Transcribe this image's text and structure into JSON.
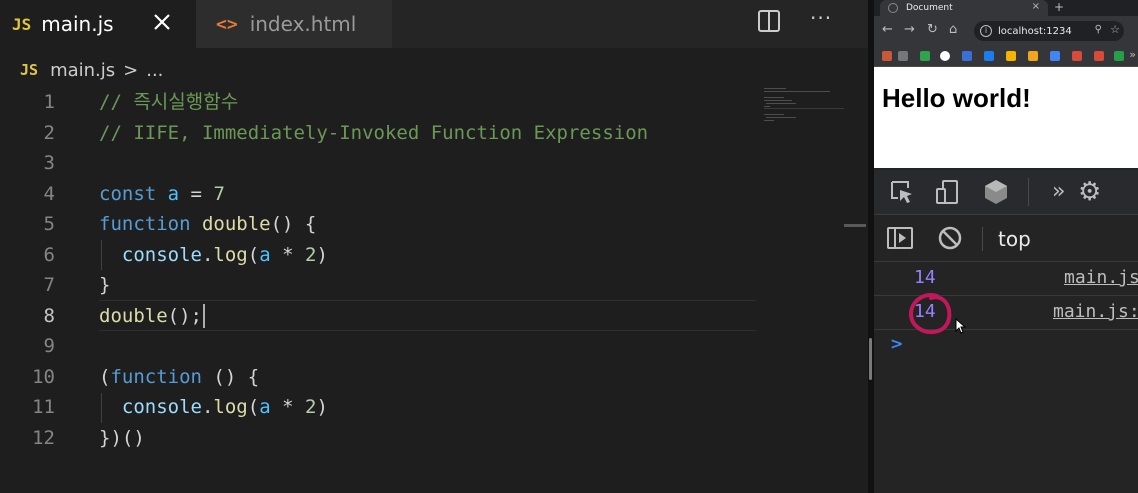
{
  "editor": {
    "tabs": [
      {
        "badge": "JS",
        "label": "main.js"
      },
      {
        "badge": "<>",
        "label": "index.html"
      }
    ],
    "more_label": "···",
    "breadcrumb": {
      "badge": "JS",
      "file": "main.js",
      "sep": ">",
      "rest": "..."
    },
    "lines": [
      "1",
      "2",
      "3",
      "4",
      "5",
      "6",
      "7",
      "8",
      "9",
      "10",
      "11",
      "12"
    ],
    "code": {
      "l1": "// 즉시실행함수",
      "l2": "// IIFE, Immediately-Invoked Function Expression",
      "kw_const": "const",
      "var_a": "a",
      "eq": " = ",
      "seven": "7",
      "kw_function": "function",
      "fn_double": "double",
      "paren_brace": "() {",
      "console": "console",
      "dot": ".",
      "log": "log",
      "paren_open": "(",
      "times": " * ",
      "two": "2",
      "paren_close": ")",
      "brace_close": "}",
      "call_double": "double",
      "call_end": "();",
      "iife_open": "(",
      "iife_kw": "function",
      "iife_rest": " () {",
      "iife_close": "})()"
    }
  },
  "browser": {
    "tab_title": "Document",
    "tab_close": "×",
    "new_tab": "+",
    "url": "localhost:1234",
    "heading": "Hello world!",
    "console_context": "top",
    "logs": [
      {
        "value": "14",
        "source": "main.js"
      },
      {
        "value": "14",
        "source": "main.js:"
      }
    ],
    "prompt": ">"
  }
}
